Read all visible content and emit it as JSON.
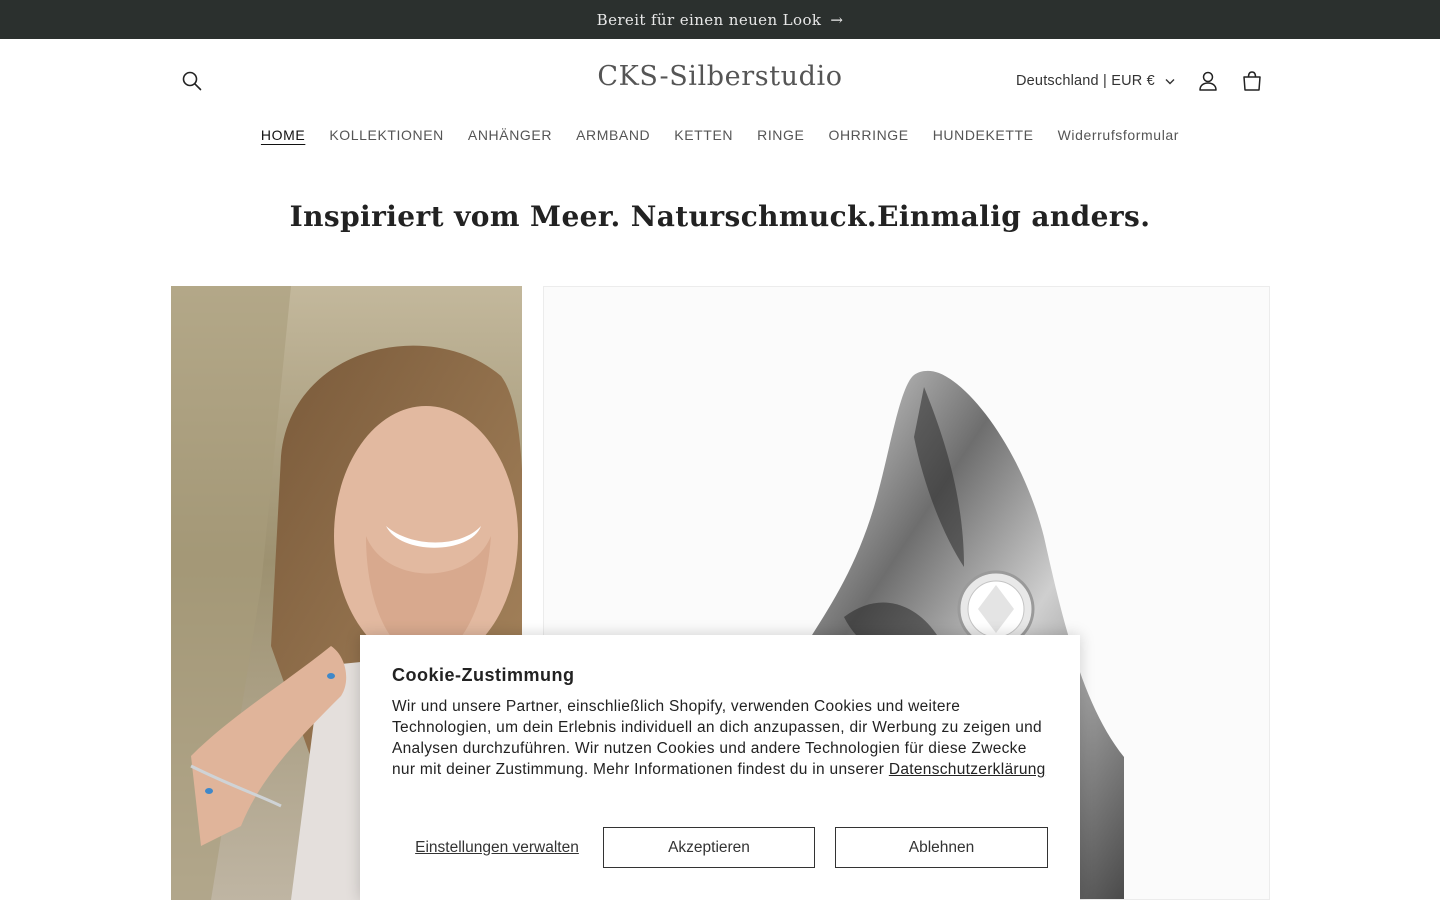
{
  "announcement": {
    "text": "Bereit für einen neuen Look",
    "arrow": "→"
  },
  "header": {
    "logo": "CKS-Silberstudio",
    "locale": "Deutschland | EUR €",
    "icons": [
      "search-icon",
      "account-icon",
      "cart-icon",
      "chevron-down-icon"
    ]
  },
  "nav": {
    "items": [
      {
        "label": "HOME",
        "active": true
      },
      {
        "label": "KOLLEKTIONEN"
      },
      {
        "label": "ANHÄNGER"
      },
      {
        "label": "ARMBAND"
      },
      {
        "label": "KETTEN"
      },
      {
        "label": "RINGE"
      },
      {
        "label": "OHRRINGE"
      },
      {
        "label": "HUNDEKETTE"
      },
      {
        "label": "Widerrufsformular"
      }
    ]
  },
  "hero": {
    "title": "Inspiriert vom Meer. Naturschmuck.Einmalig anders."
  },
  "cookie_banner": {
    "title": "Cookie-Zustimmung",
    "text": "Wir und unsere Partner, einschließlich Shopify, verwenden Cookies und weitere Technologien, um dein Erlebnis individuell an dich anzupassen, dir Werbung zu zeigen und Analysen durchzuführen. Wir nutzen Cookies und andere Technologien für diese Zwecke nur mit deiner Zustimmung. Mehr Informationen findest du in unserer",
    "privacy_link": "Datenschutzerklärung",
    "manage_label": "Einstellungen verwalten",
    "accept_label": "Akzeptieren",
    "decline_label": "Ablehnen"
  },
  "colors": {
    "announcement_bg": "#2b302e",
    "text": "#121212"
  }
}
